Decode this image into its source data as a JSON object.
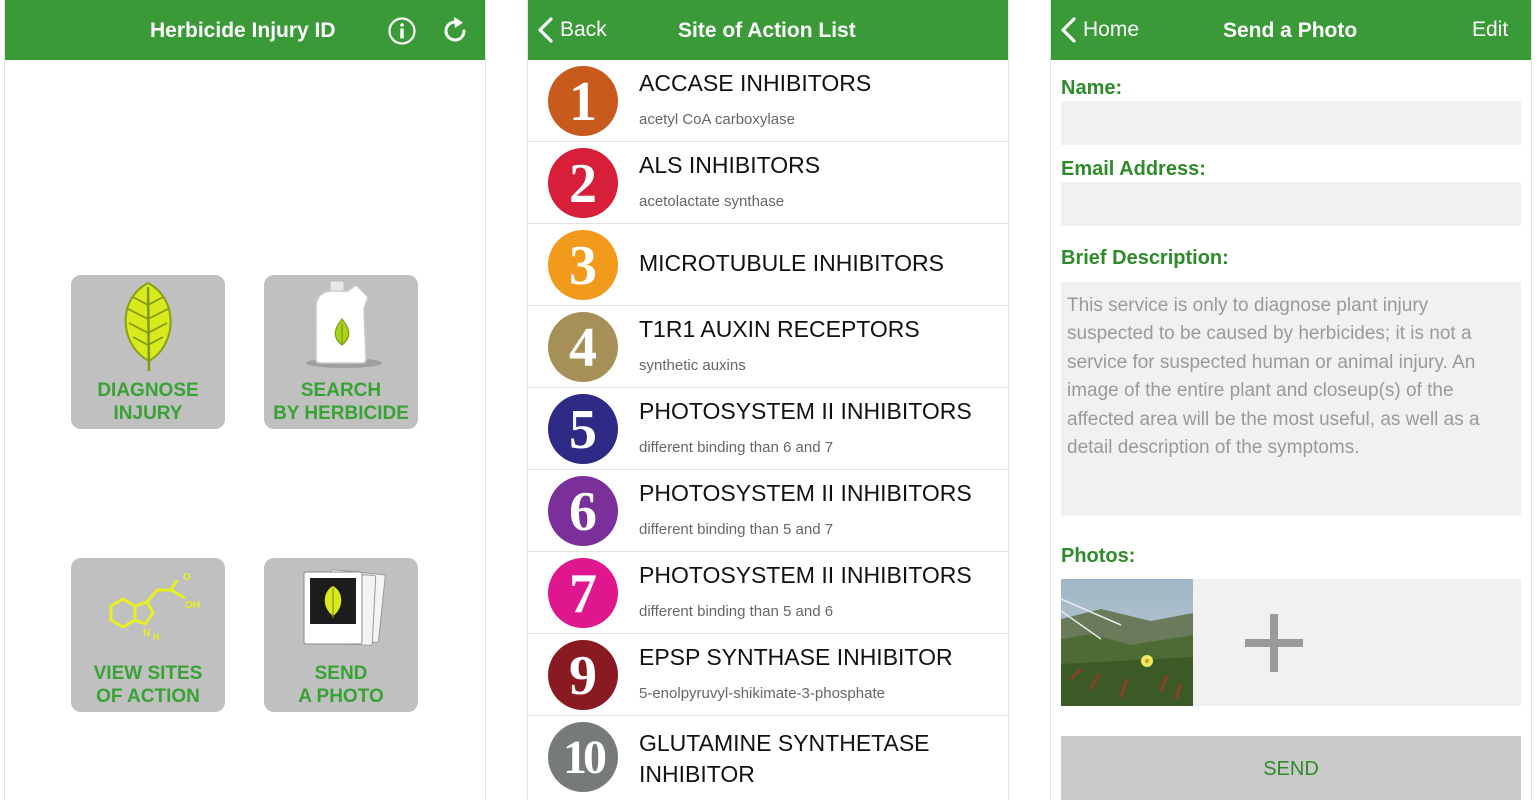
{
  "home": {
    "title": "Herbicide Injury ID",
    "tiles": [
      {
        "line1": "DIAGNOSE",
        "line2": "INJURY"
      },
      {
        "line1": "SEARCH",
        "line2": "BY HERBICIDE"
      },
      {
        "line1": "VIEW SITES",
        "line2": "OF ACTION"
      },
      {
        "line1": "SEND",
        "line2": "A PHOTO"
      }
    ],
    "molecule_label": "OH"
  },
  "soa": {
    "back_label": "Back",
    "title": "Site of Action List",
    "items": [
      {
        "num": "1",
        "name": "ACCASE INHIBITORS",
        "sub": "acetyl CoA carboxylase",
        "color": "#c85a1e"
      },
      {
        "num": "2",
        "name": "ALS INHIBITORS",
        "sub": "acetolactate synthase",
        "color": "#d81f3a"
      },
      {
        "num": "3",
        "name": "MICROTUBULE INHIBITORS",
        "sub": "",
        "color": "#f29a1c"
      },
      {
        "num": "4",
        "name": "T1R1 AUXIN RECEPTORS",
        "sub": "synthetic auxins",
        "color": "#a69058"
      },
      {
        "num": "5",
        "name": "PHOTOSYSTEM II INHIBITORS",
        "sub": "different binding than 6 and 7",
        "color": "#2e2a86"
      },
      {
        "num": "6",
        "name": "PHOTOSYSTEM II INHIBITORS",
        "sub": "different binding than 5 and 7",
        "color": "#7a2f9a"
      },
      {
        "num": "7",
        "name": "PHOTOSYSTEM II INHIBITORS",
        "sub": "different binding than 5 and 6",
        "color": "#e0168f"
      },
      {
        "num": "9",
        "name": "EPSP SYNTHASE INHIBITOR",
        "sub": "5-enolpyruvyl-shikimate-3-phosphate",
        "color": "#8a1a22"
      },
      {
        "num": "10",
        "name": "GLUTAMINE SYNTHETASE INHIBITOR",
        "sub": "",
        "color": "#777a7a"
      }
    ]
  },
  "photo": {
    "home_label": "Home",
    "title": "Send a Photo",
    "edit_label": "Edit",
    "name_label": "Name:",
    "email_label": "Email Address:",
    "desc_label": "Brief Description:",
    "desc_placeholder": "This service is only to diagnose plant injury suspected to be caused by herbicides; it is not a service for suspected human or animal injury. An image of the entire plant and closeup(s) of the affected area will be the most useful, as well as a detail description of the symptoms.",
    "photos_label": "Photos:",
    "send_label": "SEND"
  },
  "colors": {
    "nav": "#3a9a38",
    "accent": "#2e8b2a",
    "tile": "#c0c0c0"
  }
}
